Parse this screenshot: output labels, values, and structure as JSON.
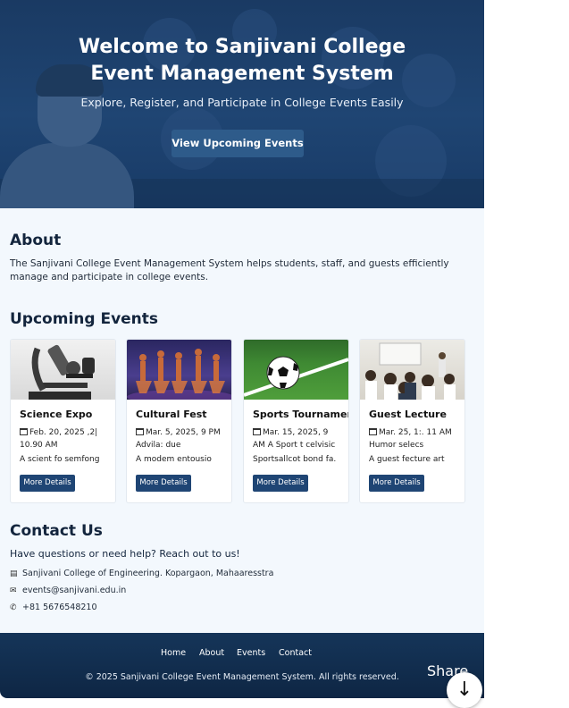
{
  "hero": {
    "title": "Welcome to Sanjivani College\nEvent Management System",
    "subtitle": "Explore, Register, and Participate in College Events Easily",
    "cta_label": "View Upcoming Events"
  },
  "about": {
    "heading": "About",
    "text": "The Sanjivani College Event Management System helps students, staff, and guests efficiently manage and participate in college events."
  },
  "events": {
    "heading": "Upcoming Events",
    "items": [
      {
        "title": "Science Expo",
        "date": "Feb. 20, 2025 ,2| 10.90 AM",
        "desc": "A scient fo semfong",
        "button": "More Details",
        "image": "microscope-image"
      },
      {
        "title": "Cultural Fest",
        "date": "Mar. 5, 2025, 9 PM Advilа: due",
        "desc": "A modem entousio",
        "button": "More Details",
        "image": "dance-image"
      },
      {
        "title": "Sports Tournament",
        "date": "Mar. 15, 2025, 9 AM A Sport t celvisic",
        "desc": "Sportsallcot bond fa.",
        "button": "More Details",
        "image": "football-image"
      },
      {
        "title": "Guest Lecture",
        "date": "Mar. 25, 1:. 11 AM Humor selecs",
        "desc": "A guest fecture art",
        "button": "More Details",
        "image": "lecture-image"
      }
    ]
  },
  "contact": {
    "heading": "Contact Us",
    "lead": "Have questions or need help? Reach out to us!",
    "address": "Sanjivani College of Engineering. Kopargaon, Mahaaresstra",
    "email": "events@sanjivani.edu.in",
    "phone": "+81 5676548210"
  },
  "footer": {
    "nav": [
      "Home",
      "About",
      "Events",
      "Contact"
    ],
    "copyright": "© 2025 Sanjivani College Event Management System. All rights reserved."
  },
  "share": {
    "label": "Share",
    "icon": "arrow-down-icon"
  },
  "colors": {
    "primary": "#1f4574",
    "hero_bg": "#1f4573",
    "footer_bg": "#0e2644",
    "page_bg": "#f3f8fd"
  }
}
